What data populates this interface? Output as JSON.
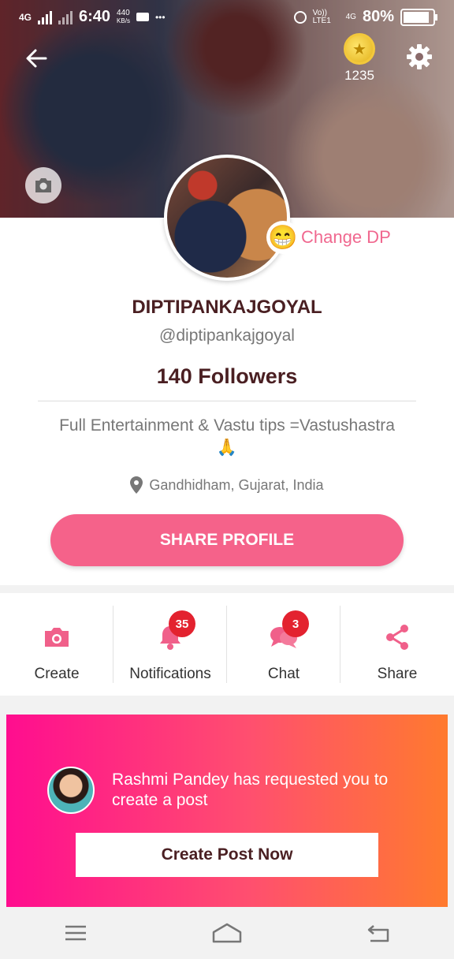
{
  "statusbar": {
    "net_left": "4G",
    "time": "6:40",
    "speed_val": "440",
    "speed_unit": "KB/s",
    "dots": "•••",
    "volte": "Vo)) LTE1",
    "net_right": "4G",
    "battery": "80%"
  },
  "header": {
    "coins": "1235",
    "icons": [
      "back-arrow-icon",
      "coin-icon",
      "gear-icon",
      "camera-icon"
    ]
  },
  "profile": {
    "change_dp": "Change DP",
    "name": "DIPTIPANKAJGOYAL",
    "handle": "@diptipankajgoyal",
    "followers": "140 Followers",
    "bio": "Full Entertainment & Vastu tips =Vastushastra",
    "bio_emoji": "🙏",
    "location": "Gandhidham, Gujarat, India",
    "share_label": "SHARE PROFILE",
    "avatar_emoji": "😁"
  },
  "actions": [
    {
      "label": "Create",
      "icon": "camera-icon"
    },
    {
      "label": "Notifications",
      "icon": "bell-icon",
      "badge": "35"
    },
    {
      "label": "Chat",
      "icon": "chat-icon",
      "badge": "3"
    },
    {
      "label": "Share",
      "icon": "share-icon"
    }
  ],
  "promo": {
    "text": "Rashmi Pandey has requested you to create a post",
    "button": "Create Post Now"
  },
  "colors": {
    "accent": "#f5628a",
    "name_text": "#4a1f22",
    "badge": "#e3222f",
    "promo_start": "#ff0d8f",
    "promo_end": "#ff7a2e"
  }
}
